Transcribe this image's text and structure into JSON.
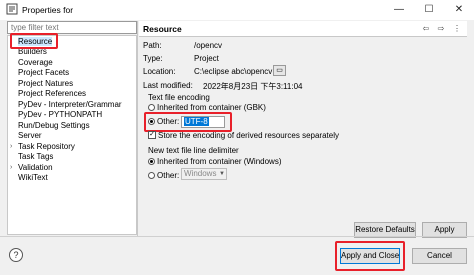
{
  "window": {
    "title": "Properties for",
    "minimize_glyph": "—",
    "maximize_glyph": "☐",
    "close_glyph": "✕"
  },
  "sidebar": {
    "filter_placeholder": "type filter text",
    "items": [
      {
        "label": "Resource",
        "expandable": true,
        "selected": true
      },
      {
        "label": "Builders",
        "expandable": false
      },
      {
        "label": "Coverage",
        "expandable": false
      },
      {
        "label": "Project Facets",
        "expandable": false
      },
      {
        "label": "Project Natures",
        "expandable": false
      },
      {
        "label": "Project References",
        "expandable": false
      },
      {
        "label": "PyDev - Interpreter/Grammar",
        "expandable": false
      },
      {
        "label": "PyDev - PYTHONPATH",
        "expandable": false
      },
      {
        "label": "Run/Debug Settings",
        "expandable": false
      },
      {
        "label": "Server",
        "expandable": false
      },
      {
        "label": "Task Repository",
        "expandable": true
      },
      {
        "label": "Task Tags",
        "expandable": false
      },
      {
        "label": "Validation",
        "expandable": true
      },
      {
        "label": "WikiText",
        "expandable": false
      }
    ]
  },
  "page": {
    "title": "Resource",
    "nav_back": "⇦",
    "nav_forward": "⇨",
    "menu": "⋮",
    "path_label": "Path:",
    "path_value": "/opencv",
    "type_label": "Type:",
    "type_value": "Project",
    "location_label": "Location:",
    "location_value": "C:\\eclipse abc\\opencv",
    "browse_glyph": "▭",
    "modified_label": "Last modified:",
    "modified_value": "2022年8月23日 下午3:11:04",
    "encoding": {
      "group_title": "Text file encoding",
      "inherited_label": "Inherited from container (GBK)",
      "other_label": "Other:",
      "other_value": "UTF-8",
      "store_label": "Store the encoding of derived resources separately",
      "store_checked": true
    },
    "delimiter": {
      "group_title": "New text file line delimiter",
      "inherited_label": "Inherited from container (Windows)",
      "other_label": "Other:",
      "other_value": "Windows"
    },
    "restore_defaults": "Restore Defaults",
    "apply": "Apply"
  },
  "footer": {
    "help_glyph": "?",
    "apply_close": "Apply and Close",
    "cancel": "Cancel"
  },
  "colors": {
    "highlight": "#e8202a",
    "selection": "#cce8ff",
    "accent": "#0078d7"
  }
}
